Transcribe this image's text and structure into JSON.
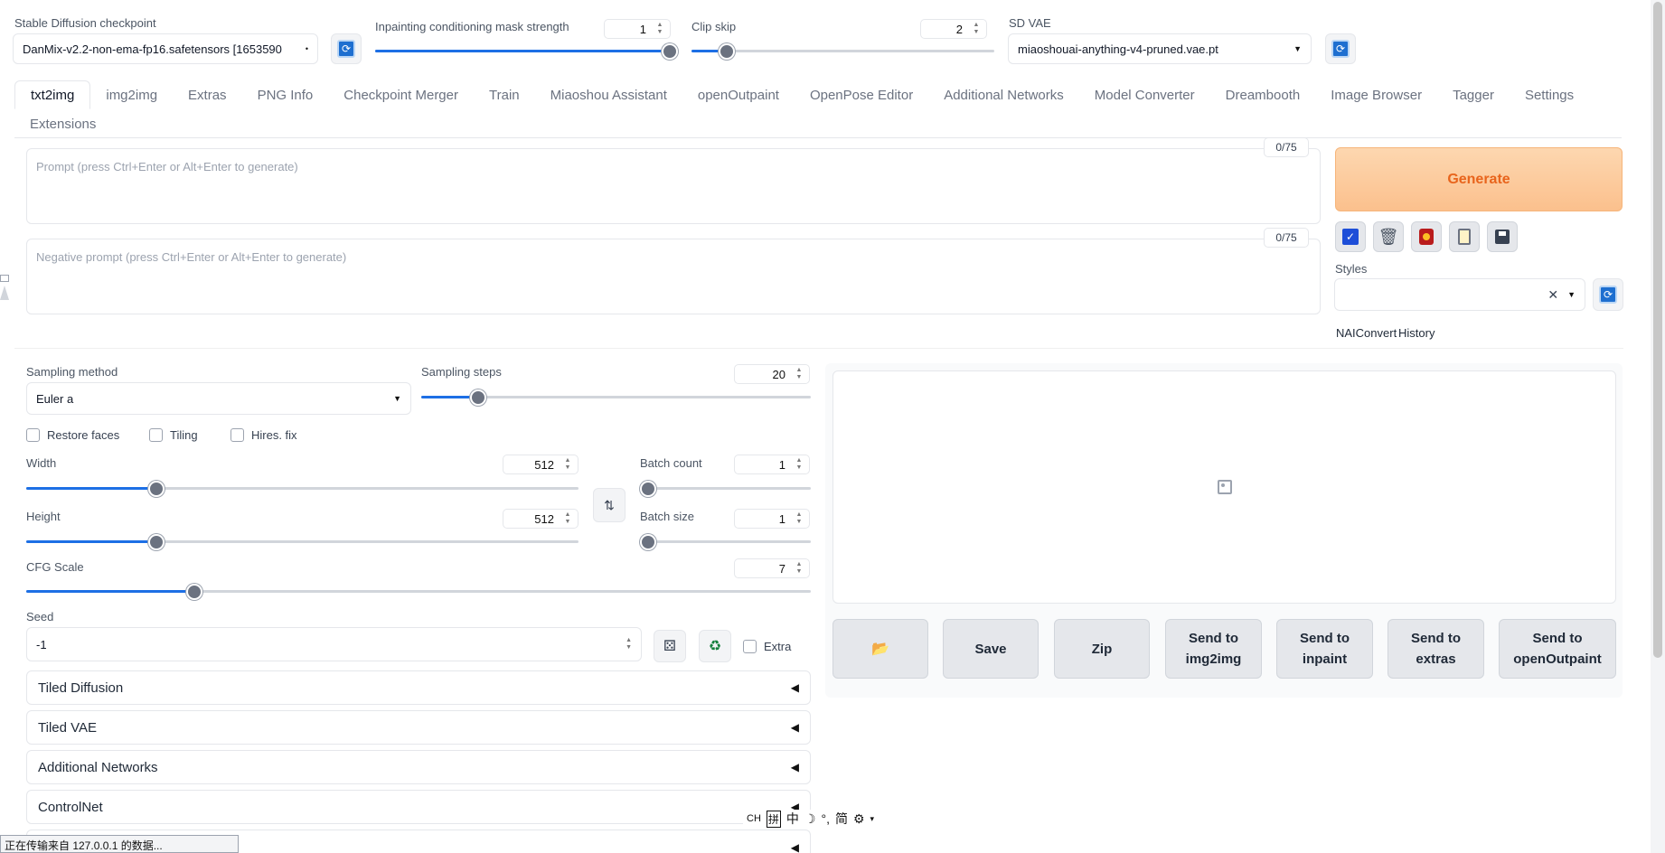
{
  "top": {
    "checkpoint_label": "Stable Diffusion checkpoint",
    "checkpoint_value": "DanMix-v2.2-non-ema-fp16.safetensors [1653590",
    "inpaint_label": "Inpainting conditioning mask strength",
    "inpaint_value": "1",
    "clip_label": "Clip skip",
    "clip_value": "2",
    "vae_label": "SD VAE",
    "vae_value": "miaoshouai-anything-v4-pruned.vae.pt"
  },
  "tabs": [
    "txt2img",
    "img2img",
    "Extras",
    "PNG Info",
    "Checkpoint Merger",
    "Train",
    "Miaoshou Assistant",
    "openOutpaint",
    "OpenPose Editor",
    "Additional Networks",
    "Model Converter",
    "Dreambooth",
    "Image Browser",
    "Tagger",
    "Settings",
    "Extensions"
  ],
  "prompt": {
    "placeholder": "Prompt (press Ctrl+Enter or Alt+Enter to generate)",
    "counter": "0/75",
    "neg_placeholder": "Negative prompt (press Ctrl+Enter or Alt+Enter to generate)",
    "neg_counter": "0/75"
  },
  "generate_label": "Generate",
  "styles_label": "Styles",
  "naiconvert_label": "NAIConvert",
  "history_label": "History",
  "sampling": {
    "method_label": "Sampling method",
    "method_value": "Euler a",
    "steps_label": "Sampling steps",
    "steps_value": "20"
  },
  "checks": {
    "restore": "Restore faces",
    "tiling": "Tiling",
    "hires": "Hires. fix",
    "extra": "Extra"
  },
  "dims": {
    "width_label": "Width",
    "width_value": "512",
    "height_label": "Height",
    "height_value": "512",
    "batch_count_label": "Batch count",
    "batch_count_value": "1",
    "batch_size_label": "Batch size",
    "batch_size_value": "1",
    "cfg_label": "CFG Scale",
    "cfg_value": "7"
  },
  "seed": {
    "label": "Seed",
    "value": "-1"
  },
  "accordions": [
    "Tiled Diffusion",
    "Tiled VAE",
    "Additional Networks",
    "ControlNet"
  ],
  "output_buttons": {
    "save": "Save",
    "zip": "Zip",
    "img2img_1": "Send to",
    "img2img_2": "img2img",
    "inpaint_1": "Send to",
    "inpaint_2": "inpaint",
    "extras_1": "Send to",
    "extras_2": "extras",
    "outpaint_1": "Send to",
    "outpaint_2": "openOutpaint"
  },
  "ime_bar": {
    "ch": "CH",
    "pin": "拼",
    "zhong": "中",
    "jian": "简"
  },
  "status_text": "正在传输来自 127.0.0.1 的数据..."
}
